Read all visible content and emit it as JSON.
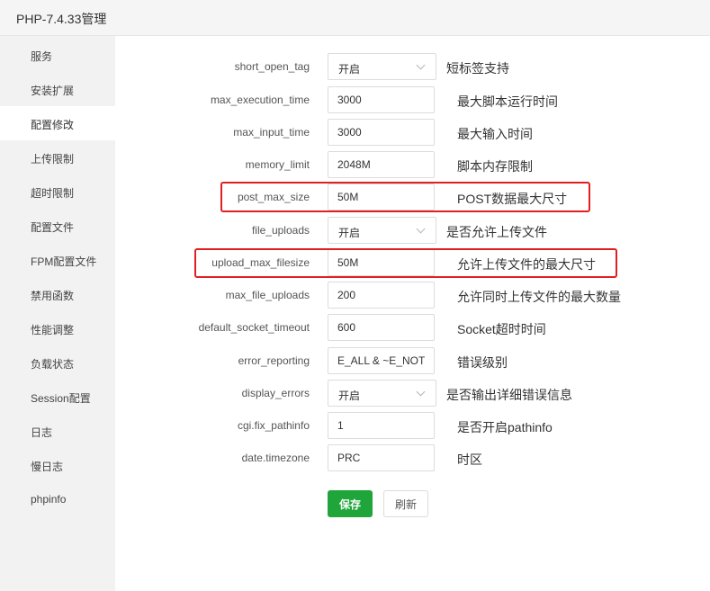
{
  "window": {
    "title": "PHP-7.4.33管理"
  },
  "sidebar": {
    "active_index": 2,
    "items": [
      {
        "label": "服务"
      },
      {
        "label": "安装扩展"
      },
      {
        "label": "配置修改"
      },
      {
        "label": "上传限制"
      },
      {
        "label": "超时限制"
      },
      {
        "label": "配置文件"
      },
      {
        "label": "FPM配置文件"
      },
      {
        "label": "禁用函数"
      },
      {
        "label": "性能调整"
      },
      {
        "label": "负载状态"
      },
      {
        "label": "Session配置"
      },
      {
        "label": "日志"
      },
      {
        "label": "慢日志"
      },
      {
        "label": "phpinfo"
      }
    ]
  },
  "settings": [
    {
      "key": "short_open_tag",
      "type": "select",
      "value": "开启",
      "desc": "短标签支持"
    },
    {
      "key": "max_execution_time",
      "type": "input",
      "value": "3000",
      "desc": "最大脚本运行时间"
    },
    {
      "key": "max_input_time",
      "type": "input",
      "value": "3000",
      "desc": "最大输入时间"
    },
    {
      "key": "memory_limit",
      "type": "input",
      "value": "2048M",
      "desc": "脚本内存限制"
    },
    {
      "key": "post_max_size",
      "type": "input",
      "value": "50M",
      "desc": "POST数据最大尺寸"
    },
    {
      "key": "file_uploads",
      "type": "select",
      "value": "开启",
      "desc": "是否允许上传文件"
    },
    {
      "key": "upload_max_filesize",
      "type": "input",
      "value": "50M",
      "desc": "允许上传文件的最大尺寸"
    },
    {
      "key": "max_file_uploads",
      "type": "input",
      "value": "200",
      "desc": "允许同时上传文件的最大数量"
    },
    {
      "key": "default_socket_timeout",
      "type": "input",
      "value": "600",
      "desc": "Socket超时时间"
    },
    {
      "key": "error_reporting",
      "type": "input",
      "value": "E_ALL & ~E_NOTICE",
      "desc": "错误级别"
    },
    {
      "key": "display_errors",
      "type": "select",
      "value": "开启",
      "desc": "是否输出详细错误信息"
    },
    {
      "key": "cgi.fix_pathinfo",
      "type": "input",
      "value": "1",
      "desc": "是否开启pathinfo"
    },
    {
      "key": "date.timezone",
      "type": "input",
      "value": "PRC",
      "desc": "时区"
    }
  ],
  "actions": {
    "save_label": "保存",
    "refresh_label": "刷新"
  },
  "colors": {
    "primary": "#20a53a",
    "highlight": "#e02020",
    "sidebar_bg": "#f2f2f2"
  }
}
